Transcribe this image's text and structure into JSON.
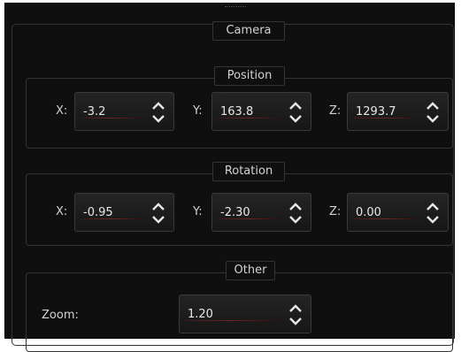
{
  "camera": {
    "title": "Camera"
  },
  "position": {
    "title": "Position",
    "x": {
      "label": "X:",
      "value": "-3.2"
    },
    "y": {
      "label": "Y:",
      "value": "163.8"
    },
    "z": {
      "label": "Z:",
      "value": "1293.7"
    }
  },
  "rotation": {
    "title": "Rotation",
    "x": {
      "label": "X:",
      "value": "-0.95"
    },
    "y": {
      "label": "Y:",
      "value": "-2.30"
    },
    "z": {
      "label": "Z:",
      "value": "0.00"
    }
  },
  "other": {
    "title": "Other",
    "zoom": {
      "label": "Zoom:",
      "value": "1.20"
    }
  },
  "icons": {
    "stepper": "chevron-updown-icon"
  }
}
